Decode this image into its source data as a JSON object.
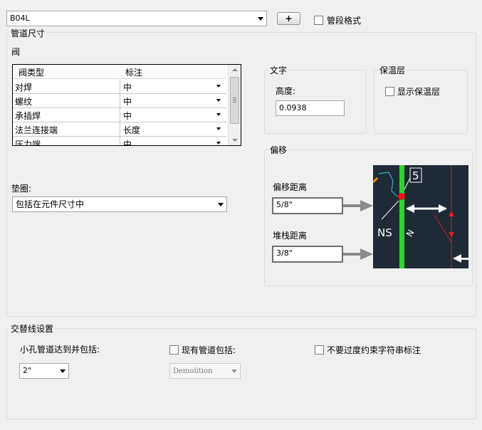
{
  "top": {
    "spec_value": "B04L",
    "add_button": "+",
    "segment_format_label": "管段格式"
  },
  "pipe_size": {
    "title": "管道尺寸",
    "valve_label": "阀",
    "table": {
      "headers": [
        "阀类型",
        "标注"
      ],
      "rows": [
        {
          "type": "对焊",
          "label": "中"
        },
        {
          "type": "螺纹",
          "label": "中"
        },
        {
          "type": "承插焊",
          "label": "中"
        },
        {
          "type": "法兰连接端",
          "label": "长度"
        },
        {
          "type": "压力端",
          "label": "中"
        }
      ]
    },
    "gasket_label": "垫圈:",
    "gasket_value": "包括在元件尺寸中"
  },
  "text_group": {
    "title": "文字",
    "height_label": "高度:",
    "height_value": "0.0938"
  },
  "insulation_group": {
    "title": "保温层",
    "show_label": "显示保温层"
  },
  "offset_group": {
    "title": "偏移",
    "offset_distance_label": "偏移距离",
    "offset_distance_value": "5/8\"",
    "stack_distance_label": "堆栈距离",
    "stack_distance_value": "3/8\"",
    "preview": {
      "tag": "5",
      "ns": "NS",
      "background": "#1e2a36",
      "pipe_color": "#22dd22"
    }
  },
  "alt_line": {
    "title": "交替线设置",
    "small_bore_label": "小孔管道达到并包括:",
    "small_bore_value": "2\"",
    "existing_pipe_label": "现有管道包括:",
    "existing_pipe_value": "Demolition",
    "no_overconstrain_label": "不要过度约束字符串标注"
  }
}
